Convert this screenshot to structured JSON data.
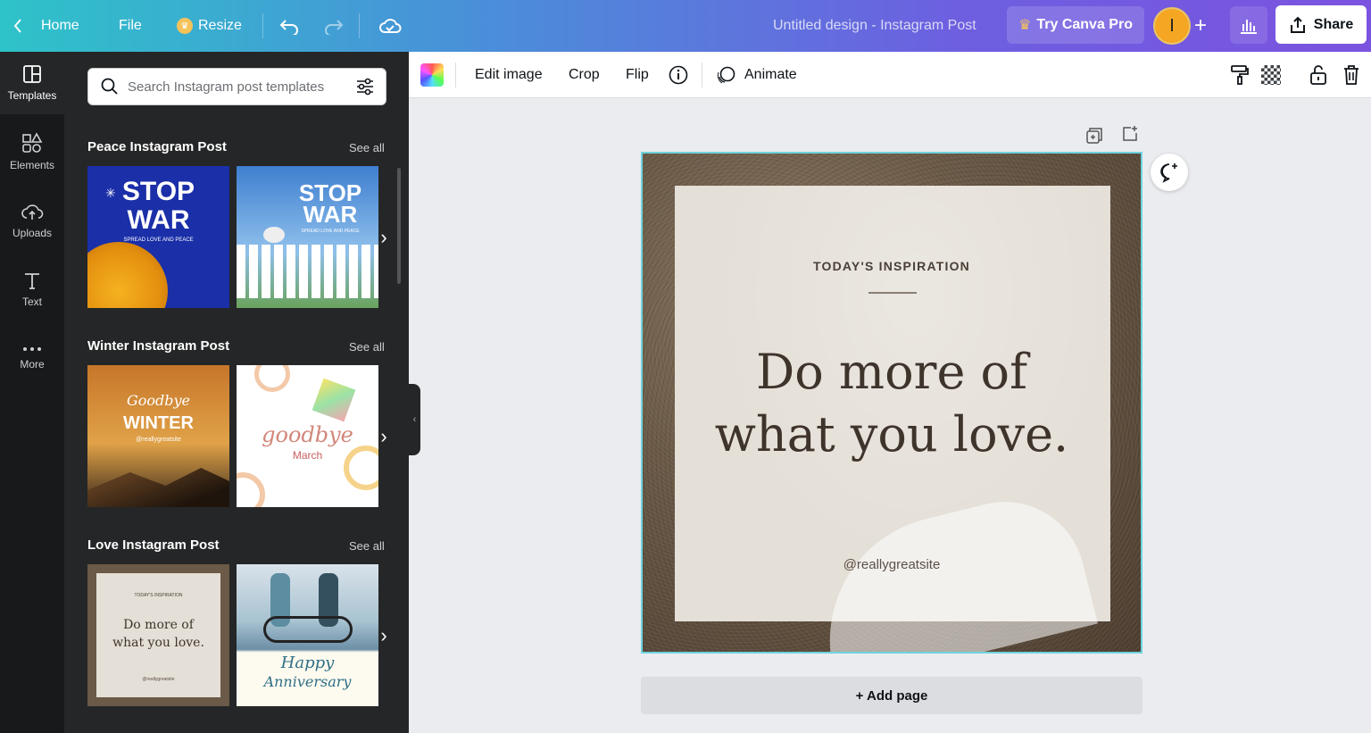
{
  "topbar": {
    "home_label": "Home",
    "file_label": "File",
    "resize_label": "Resize",
    "doc_title": "Untitled design - Instagram Post",
    "try_pro_label": "Try Canva Pro",
    "avatar_initial": "I",
    "share_label": "Share"
  },
  "rail": [
    {
      "label": "Templates",
      "icon": "templates-icon"
    },
    {
      "label": "Elements",
      "icon": "elements-icon"
    },
    {
      "label": "Uploads",
      "icon": "upload-icon"
    },
    {
      "label": "Text",
      "icon": "text-icon"
    },
    {
      "label": "More",
      "icon": "more-icon"
    }
  ],
  "panel": {
    "search_placeholder": "Search Instagram post templates",
    "see_all": "See all",
    "sections": [
      {
        "title": "Peace Instagram Post",
        "thumbs": [
          {
            "line1": "STOP",
            "line2": "WAR",
            "sub": "SPREAD LOVE AND PEACE"
          },
          {
            "line1": "STOP",
            "line2": "WAR",
            "sub": "SPREAD LOVE AND PEACE"
          }
        ]
      },
      {
        "title": "Winter Instagram Post",
        "thumbs": [
          {
            "script": "Goodbye",
            "big": "WINTER",
            "sub": "@reallygreatsite"
          },
          {
            "script": "goodbye",
            "sub": "March"
          }
        ]
      },
      {
        "title": "Love Instagram Post",
        "thumbs": [
          {
            "eyebrow": "TODAY'S INSPIRATION",
            "quote": "Do more of what you love.",
            "sub": "@reallygreatsite"
          },
          {
            "script": "Happy",
            "script2": "Anniversary"
          }
        ]
      }
    ]
  },
  "toolbar": {
    "edit_image": "Edit image",
    "crop": "Crop",
    "flip": "Flip",
    "animate": "Animate"
  },
  "design": {
    "eyebrow": "TODAY'S INSPIRATION",
    "quote_line1": "Do more of",
    "quote_line2": "what you love.",
    "handle": "@reallygreatsite"
  },
  "add_page_label": "+ Add page"
}
